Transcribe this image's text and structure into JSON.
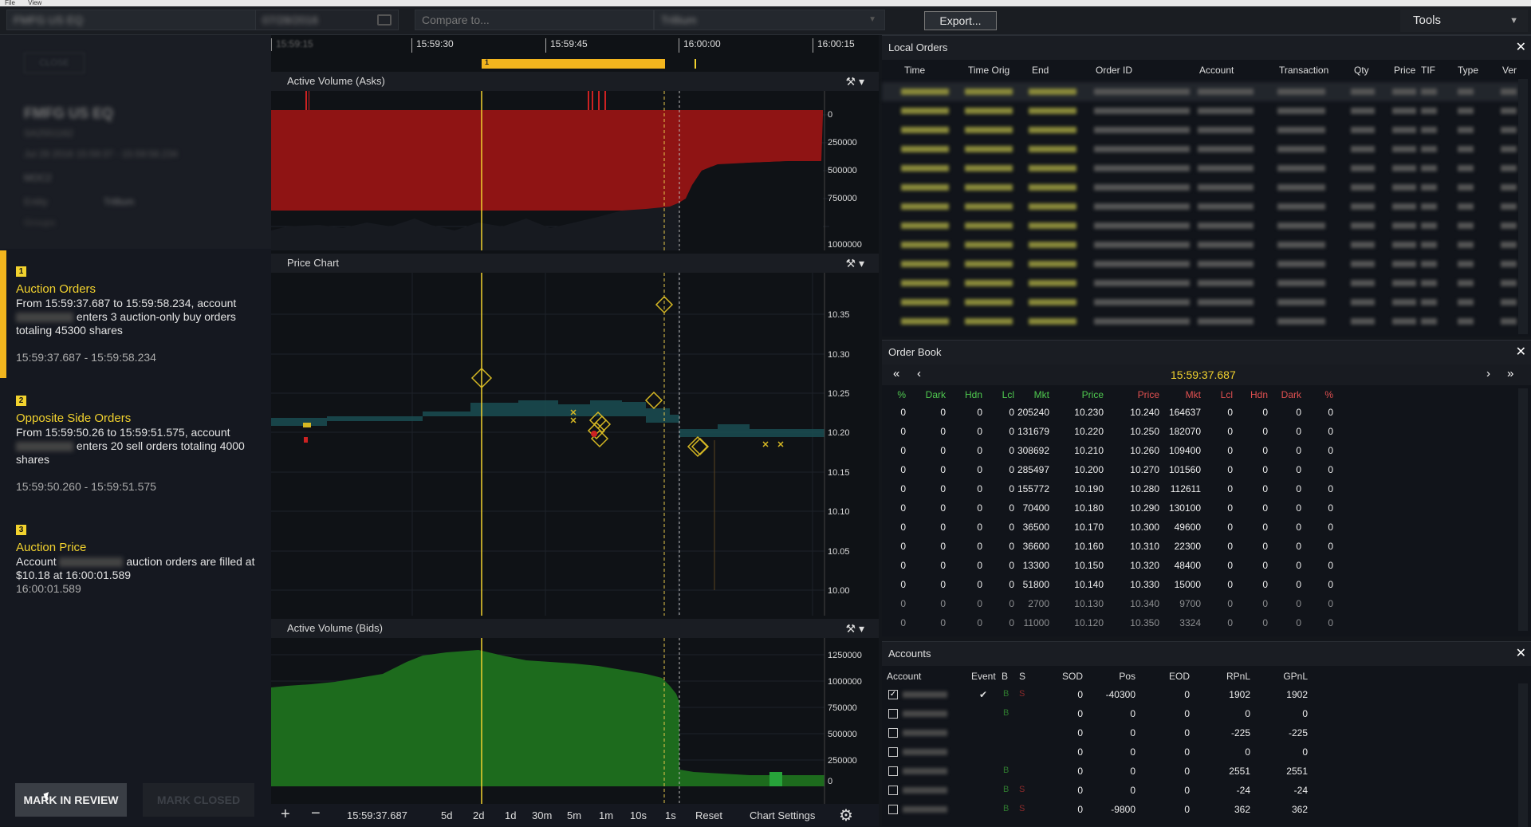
{
  "menubar": [
    "File",
    "View"
  ],
  "toolbar": {
    "symbol_field": "FMFG US EQ",
    "date_field": "07/28/2016",
    "compare_placeholder": "Compare to...",
    "venue_field": "Trillium",
    "export_label": "Export...",
    "tools_label": "Tools"
  },
  "alert_header": {
    "close_button": "CLOSE",
    "symbol": "FMFG US EQ",
    "subtitle": "SA2551162",
    "time_range": "Jul 28 2016 15:59:37 - 15:59:58.234",
    "tag": "MOC2",
    "entity_label": "Entity",
    "entity_value": "Trillium",
    "groups_label": "Groups"
  },
  "alerts": [
    {
      "num": "1",
      "title": "Auction Orders",
      "desc_pre": "From 15:59:37.687 to 15:59:58.234, account",
      "desc_post": "enters 3 auction-only buy orders totaling 45300 shares",
      "range": "15:59:37.687 - 15:59:58.234"
    },
    {
      "num": "2",
      "title": "Opposite Side Orders",
      "desc_pre": "From 15:59:50.26 to 15:59:51.575, account",
      "desc_post": "enters 20 sell orders totaling 4000 shares",
      "range": "15:59:50.260 - 15:59:51.575"
    },
    {
      "num": "3",
      "title": "Auction Price",
      "desc_pre": "Account",
      "desc_post": "auction orders are filled at $10.18 at 16:00:01.589",
      "range": "16:00:01.589"
    }
  ],
  "actions": {
    "mark_in_review": "MARK IN REVIEW",
    "mark_closed": "MARK CLOSED"
  },
  "timeline": {
    "ticks": [
      "15:59:15",
      "15:59:30",
      "15:59:45",
      "16:00:00",
      "16:00:15"
    ],
    "marker_label": "1"
  },
  "charts": {
    "asks_title": "Active Volume (Asks)",
    "price_title": "Price Chart",
    "bids_title": "Active Volume (Bids)",
    "asks_ticks": [
      "0",
      "250000",
      "500000",
      "750000",
      "1000000"
    ],
    "price_ticks": [
      "10.35",
      "10.30",
      "10.25",
      "10.20",
      "10.15",
      "10.10",
      "10.05",
      "10.00"
    ],
    "bids_ticks": [
      "1250000",
      "1000000",
      "750000",
      "500000",
      "250000",
      "0"
    ]
  },
  "bottombar": {
    "time": "15:59:37.687",
    "ranges": [
      "5d",
      "2d",
      "1d",
      "30m",
      "5m",
      "1m",
      "10s",
      "1s"
    ],
    "reset": "Reset",
    "settings": "Chart Settings"
  },
  "local_orders": {
    "title": "Local Orders",
    "columns": [
      "Time",
      "Time Orig",
      "End",
      "Order ID",
      "Account",
      "Transaction",
      "Qty",
      "Price",
      "TIF",
      "Type",
      "Ver"
    ]
  },
  "order_book": {
    "title": "Order Book",
    "time": "15:59:37.687",
    "bid_columns": [
      "%",
      "Dark",
      "Hdn",
      "Lcl",
      "Mkt",
      "Price"
    ],
    "ask_columns": [
      "Price",
      "Mkt",
      "Lcl",
      "Hdn",
      "Dark",
      "%"
    ],
    "rows": [
      [
        "0",
        "0",
        "0",
        "0",
        "205240",
        "10.230",
        "10.240",
        "164637",
        "0",
        "0",
        "0",
        "0"
      ],
      [
        "0",
        "0",
        "0",
        "0",
        "131679",
        "10.220",
        "10.250",
        "182070",
        "0",
        "0",
        "0",
        "0"
      ],
      [
        "0",
        "0",
        "0",
        "0",
        "308692",
        "10.210",
        "10.260",
        "109400",
        "0",
        "0",
        "0",
        "0"
      ],
      [
        "0",
        "0",
        "0",
        "0",
        "285497",
        "10.200",
        "10.270",
        "101560",
        "0",
        "0",
        "0",
        "0"
      ],
      [
        "0",
        "0",
        "0",
        "0",
        "155772",
        "10.190",
        "10.280",
        "112611",
        "0",
        "0",
        "0",
        "0"
      ],
      [
        "0",
        "0",
        "0",
        "0",
        "70400",
        "10.180",
        "10.290",
        "130100",
        "0",
        "0",
        "0",
        "0"
      ],
      [
        "0",
        "0",
        "0",
        "0",
        "36500",
        "10.170",
        "10.300",
        "49600",
        "0",
        "0",
        "0",
        "0"
      ],
      [
        "0",
        "0",
        "0",
        "0",
        "36600",
        "10.160",
        "10.310",
        "22300",
        "0",
        "0",
        "0",
        "0"
      ],
      [
        "0",
        "0",
        "0",
        "0",
        "13300",
        "10.150",
        "10.320",
        "48400",
        "0",
        "0",
        "0",
        "0"
      ],
      [
        "0",
        "0",
        "0",
        "0",
        "51800",
        "10.140",
        "10.330",
        "15000",
        "0",
        "0",
        "0",
        "0"
      ],
      [
        "0",
        "0",
        "0",
        "0",
        "2700",
        "10.130",
        "10.340",
        "9700",
        "0",
        "0",
        "0",
        "0"
      ],
      [
        "0",
        "0",
        "0",
        "0",
        "11000",
        "10.120",
        "10.350",
        "3324",
        "0",
        "0",
        "0",
        "0"
      ]
    ]
  },
  "accounts": {
    "title": "Accounts",
    "columns": [
      "Account",
      "Event",
      "B",
      "S",
      "SOD",
      "Pos",
      "EOD",
      "RPnL",
      "GPnL"
    ],
    "rows": [
      {
        "checked": true,
        "event": "✔",
        "b": "B",
        "s": "S",
        "sod": "0",
        "pos": "-40300",
        "eod": "0",
        "rpnl": "1902",
        "gpnl": "1902"
      },
      {
        "checked": false,
        "event": "",
        "b": "B",
        "s": "",
        "sod": "0",
        "pos": "0",
        "eod": "0",
        "rpnl": "0",
        "gpnl": "0"
      },
      {
        "checked": false,
        "event": "",
        "b": "",
        "s": "",
        "sod": "0",
        "pos": "0",
        "eod": "0",
        "rpnl": "-225",
        "gpnl": "-225"
      },
      {
        "checked": false,
        "event": "",
        "b": "",
        "s": "",
        "sod": "0",
        "pos": "0",
        "eod": "0",
        "rpnl": "0",
        "gpnl": "0"
      },
      {
        "checked": false,
        "event": "",
        "b": "B",
        "s": "",
        "sod": "0",
        "pos": "0",
        "eod": "0",
        "rpnl": "2551",
        "gpnl": "2551"
      },
      {
        "checked": false,
        "event": "",
        "b": "B",
        "s": "S",
        "sod": "0",
        "pos": "0",
        "eod": "0",
        "rpnl": "-24",
        "gpnl": "-24"
      },
      {
        "checked": false,
        "event": "",
        "b": "B",
        "s": "S",
        "sod": "0",
        "pos": "-9800",
        "eod": "0",
        "rpnl": "362",
        "gpnl": "362"
      }
    ]
  },
  "colors": {
    "accent": "#f2d22e",
    "asks": "#8f1414",
    "bids": "#1d6b1d",
    "price_line": "#1a4d52"
  }
}
